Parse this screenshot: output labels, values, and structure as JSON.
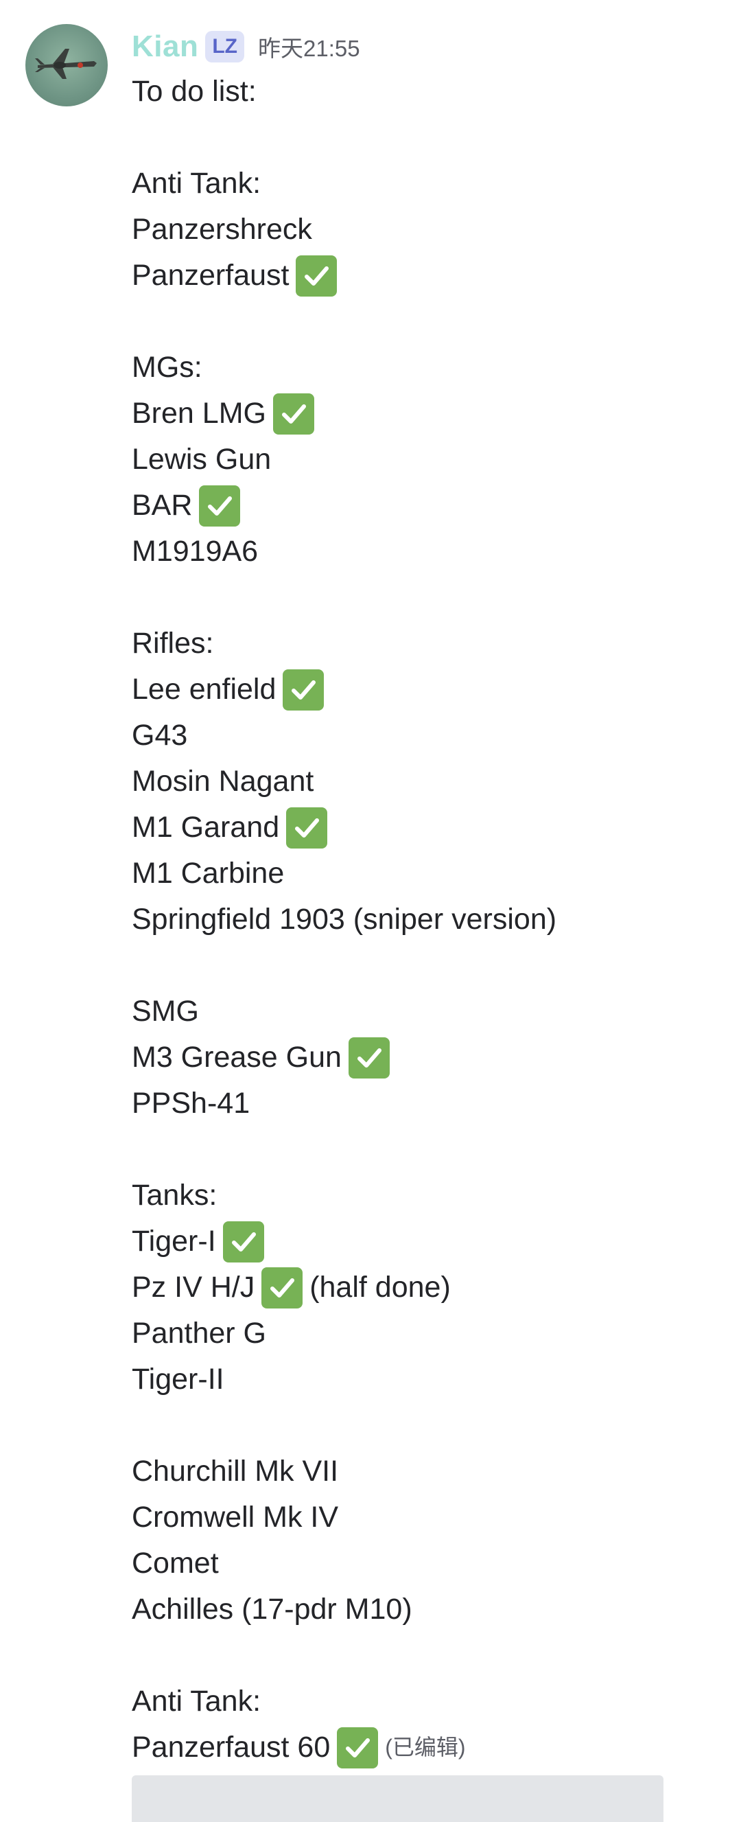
{
  "message": {
    "author": "Kian",
    "badge": "LZ",
    "timestamp": "昨天21:55",
    "edited_label": "(已编辑)",
    "lines": [
      {
        "text": "To do list:"
      },
      {
        "text": ""
      },
      {
        "text": "Anti Tank:"
      },
      {
        "text": "Panzershreck"
      },
      {
        "text": "Panzerfaust",
        "check": true
      },
      {
        "text": ""
      },
      {
        "text": "MGs:"
      },
      {
        "text": "Bren LMG",
        "check": true
      },
      {
        "text": "Lewis Gun"
      },
      {
        "text": "BAR",
        "check": true
      },
      {
        "text": "M1919A6"
      },
      {
        "text": ""
      },
      {
        "text": "Rifles:"
      },
      {
        "text": "Lee enfield",
        "check": true
      },
      {
        "text": "G43"
      },
      {
        "text": "Mosin Nagant"
      },
      {
        "text": "M1 Garand",
        "check": true
      },
      {
        "text": "M1 Carbine"
      },
      {
        "text": "Springfield 1903 (sniper version)"
      },
      {
        "text": ""
      },
      {
        "text": "SMG"
      },
      {
        "text": "M3 Grease Gun",
        "check": true
      },
      {
        "text": "PPSh-41"
      },
      {
        "text": ""
      },
      {
        "text": "Tanks:"
      },
      {
        "text": "Tiger-I",
        "check": true
      },
      {
        "text": "Pz IV H/J",
        "check": true,
        "suffix": "(half done)"
      },
      {
        "text": "Panther G"
      },
      {
        "text": "Tiger-II"
      },
      {
        "text": ""
      },
      {
        "text": "Churchill Mk VII"
      },
      {
        "text": "Cromwell Mk IV"
      },
      {
        "text": "Comet"
      },
      {
        "text": "Achilles (17-pdr M10)"
      },
      {
        "text": ""
      },
      {
        "text": "Anti Tank:"
      },
      {
        "text": "Panzerfaust 60",
        "check": true,
        "edited": true
      }
    ]
  },
  "icons": {
    "avatar": "plane-avatar-icon",
    "check": "check-mark-icon"
  },
  "colors": {
    "username": "#9ee0d6",
    "badge_bg": "#dfe3f8",
    "badge_text": "#5865c8",
    "check_bg": "#77b255",
    "embed_bg": "#e3e5e8"
  }
}
